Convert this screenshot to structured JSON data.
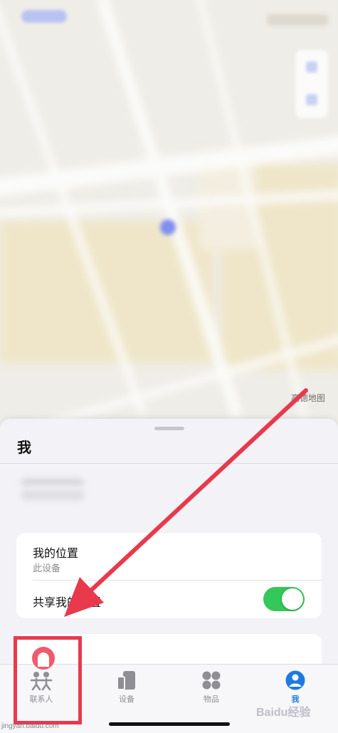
{
  "map": {
    "credit": "高德地图"
  },
  "sheet": {
    "title": "我",
    "my_location": {
      "title": "我的位置",
      "subtitle": "此设备"
    },
    "share_location": {
      "label": "共享我的位置",
      "enabled": true
    }
  },
  "tabs": [
    {
      "label": "联系人",
      "icon": "people-icon",
      "active": false
    },
    {
      "label": "设备",
      "icon": "devices-icon",
      "active": false
    },
    {
      "label": "物品",
      "icon": "items-icon",
      "active": false
    },
    {
      "label": "我",
      "icon": "person-circle-icon",
      "active": true
    }
  ],
  "colors": {
    "accent": "#1f7ae0",
    "toggle_on": "#34c759",
    "annotation_red": "#e8394d"
  },
  "watermark": {
    "logo": "Baidu经验",
    "url": "jingyan.baidu.com"
  }
}
